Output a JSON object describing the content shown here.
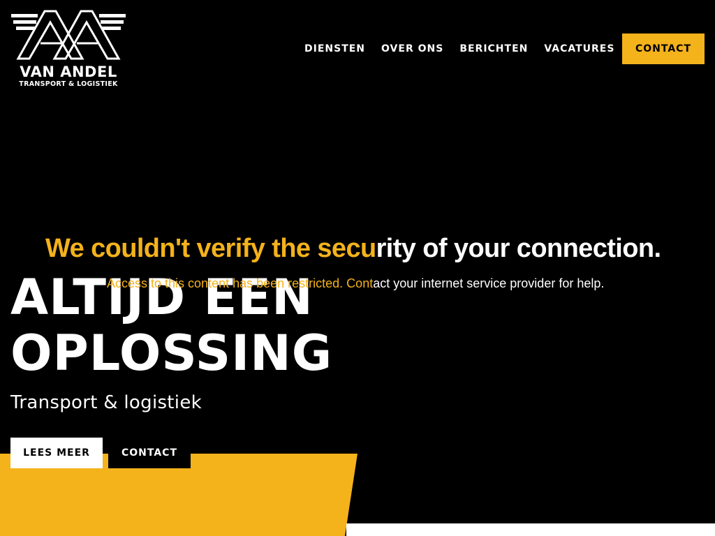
{
  "brand": {
    "logo_mark": "AVA",
    "name": "VAN ANDEL",
    "tagline": "TRANSPORT & LOGISTIEK"
  },
  "nav": {
    "items": [
      {
        "label": "DIENSTEN"
      },
      {
        "label": "OVER ONS"
      },
      {
        "label": "BERICHTEN"
      },
      {
        "label": "VACATURES"
      }
    ],
    "contact_label": "CONTACT"
  },
  "hero": {
    "title_line1": "ALTIJD EEN",
    "title_line2": "OPLOSSING",
    "subtitle": "Transport & logistiek",
    "primary_button": "LEES MEER",
    "secondary_button": "CONTACT"
  },
  "error": {
    "title_part1": "We couldn't verify the secu",
    "title_part2": "rity of your connection.",
    "message_part1": "Access to this content has been restricted. Cont",
    "message_part2": "act your internet service provider for help."
  },
  "colors": {
    "accent": "#f4b21b",
    "background": "#000000",
    "text": "#ffffff"
  }
}
